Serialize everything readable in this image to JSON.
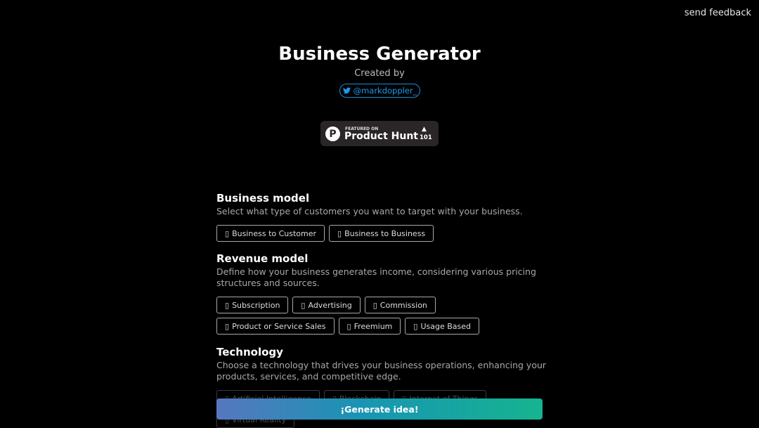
{
  "header": {
    "feedback": "send feedback",
    "title": "Business Generator",
    "created_by": "Created by",
    "twitter_handle": "@markdoppler_"
  },
  "product_hunt": {
    "featured": "FEATURED ON",
    "name": "Product Hunt",
    "logo": "P",
    "upvotes": "101"
  },
  "option_icon": "▯",
  "sections": [
    {
      "title": "Business model",
      "description": "Select what type of customers you want to target with your business.",
      "options": [
        "Business to Customer",
        "Business to Business"
      ]
    },
    {
      "title": "Revenue model",
      "description": "Define how your business generates income, considering various pricing structures and sources.",
      "options": [
        "Subscription",
        "Advertising",
        "Commission",
        "Product or Service Sales",
        "Freemium",
        "Usage Based"
      ]
    },
    {
      "title": "Technology",
      "description": "Choose a technology that drives your business operations, enhancing your products, services, and competitive edge.",
      "options": [
        "Artificial Intelligence",
        "Blockchain",
        "Internet of Things",
        "Virtual Reality"
      ]
    }
  ],
  "generate_label": "¡Generate idea!",
  "colors": {
    "twitter": "#1d9bf0",
    "gradient_start": "#5677bf",
    "gradient_end": "#16b48f"
  }
}
